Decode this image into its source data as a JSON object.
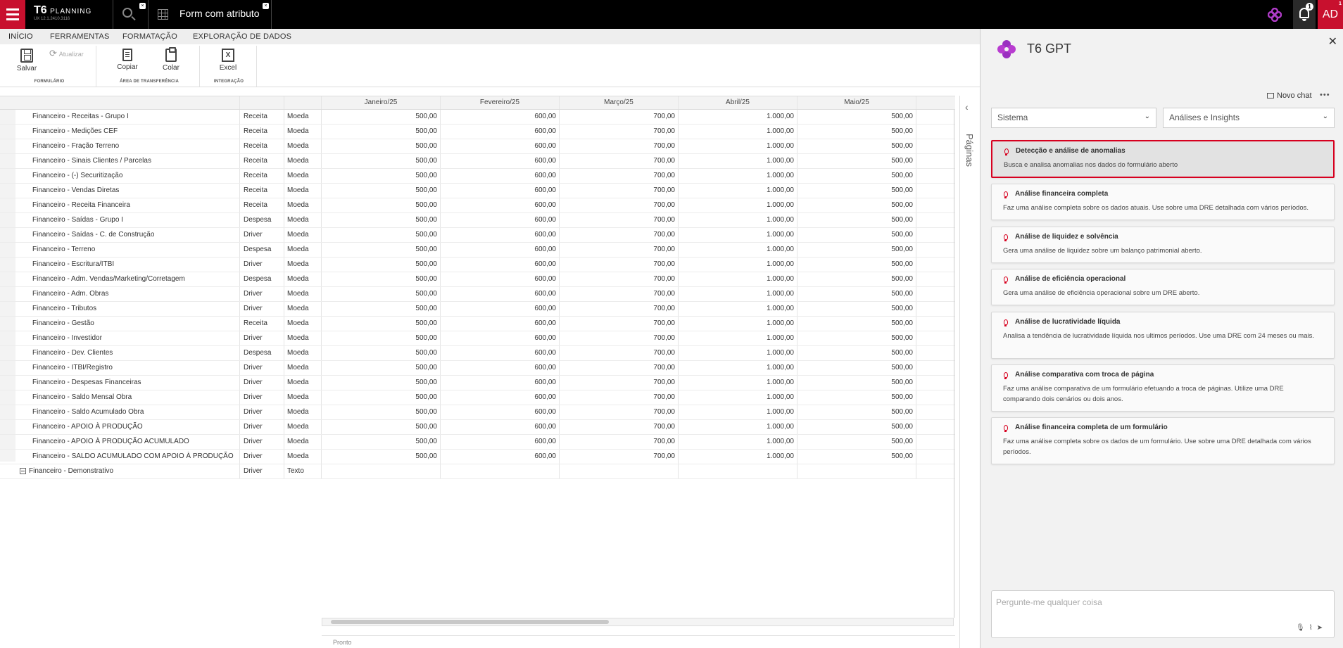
{
  "topbar": {
    "brand": "T6",
    "brand_sub": "PLANNING",
    "version": "UX 12.1.2410.3116",
    "tab_title": "Form com atributo",
    "notif_count": "1",
    "avatar": "AD",
    "avatar_badge": "1",
    "close_glyph": "×"
  },
  "ribbon": {
    "tabs": [
      "INÍCIO",
      "FERRAMENTAS",
      "FORMATAÇÃO",
      "EXPLORAÇÃO DE DADOS"
    ],
    "save": "Salvar",
    "refresh": "Atualizar",
    "copy": "Copiar",
    "paste": "Colar",
    "excel": "Excel",
    "excel_icon": "X",
    "groups": [
      "FORMULÁRIO",
      "ÁREA DE TRANSFERÊNCIA",
      "INTEGRAÇÃO"
    ]
  },
  "grid": {
    "months": [
      "Janeiro/25",
      "Fevereiro/25",
      "Março/25",
      "Abril/25",
      "Maio/25"
    ],
    "rows": [
      {
        "name": "Financeiro - Receitas - Grupo I",
        "type": "Receita",
        "unit": "Moeda",
        "v": [
          "500,00",
          "600,00",
          "700,00",
          "1.000,00",
          "500,00"
        ]
      },
      {
        "name": "Financeiro - Medições CEF",
        "type": "Receita",
        "unit": "Moeda",
        "v": [
          "500,00",
          "600,00",
          "700,00",
          "1.000,00",
          "500,00"
        ]
      },
      {
        "name": "Financeiro - Fração Terreno",
        "type": "Receita",
        "unit": "Moeda",
        "v": [
          "500,00",
          "600,00",
          "700,00",
          "1.000,00",
          "500,00"
        ]
      },
      {
        "name": "Financeiro - Sinais Clientes / Parcelas",
        "type": "Receita",
        "unit": "Moeda",
        "v": [
          "500,00",
          "600,00",
          "700,00",
          "1.000,00",
          "500,00"
        ]
      },
      {
        "name": "Financeiro - (-) Securitização",
        "type": "Receita",
        "unit": "Moeda",
        "v": [
          "500,00",
          "600,00",
          "700,00",
          "1.000,00",
          "500,00"
        ]
      },
      {
        "name": "Financeiro - Vendas Diretas",
        "type": "Receita",
        "unit": "Moeda",
        "v": [
          "500,00",
          "600,00",
          "700,00",
          "1.000,00",
          "500,00"
        ]
      },
      {
        "name": "Financeiro - Receita Financeira",
        "type": "Receita",
        "unit": "Moeda",
        "v": [
          "500,00",
          "600,00",
          "700,00",
          "1.000,00",
          "500,00"
        ]
      },
      {
        "name": "Financeiro - Saídas - Grupo I",
        "type": "Despesa",
        "unit": "Moeda",
        "v": [
          "500,00",
          "600,00",
          "700,00",
          "1.000,00",
          "500,00"
        ]
      },
      {
        "name": "Financeiro - Saídas - C. de Construção",
        "type": "Driver",
        "unit": "Moeda",
        "v": [
          "500,00",
          "600,00",
          "700,00",
          "1.000,00",
          "500,00"
        ]
      },
      {
        "name": "Financeiro - Terreno",
        "type": "Despesa",
        "unit": "Moeda",
        "v": [
          "500,00",
          "600,00",
          "700,00",
          "1.000,00",
          "500,00"
        ]
      },
      {
        "name": "Financeiro - Escritura/ITBI",
        "type": "Driver",
        "unit": "Moeda",
        "v": [
          "500,00",
          "600,00",
          "700,00",
          "1.000,00",
          "500,00"
        ]
      },
      {
        "name": "Financeiro - Adm. Vendas/Marketing/Corretagem",
        "type": "Despesa",
        "unit": "Moeda",
        "v": [
          "500,00",
          "600,00",
          "700,00",
          "1.000,00",
          "500,00"
        ]
      },
      {
        "name": "Financeiro - Adm. Obras",
        "type": "Driver",
        "unit": "Moeda",
        "v": [
          "500,00",
          "600,00",
          "700,00",
          "1.000,00",
          "500,00"
        ]
      },
      {
        "name": "Financeiro - Tributos",
        "type": "Driver",
        "unit": "Moeda",
        "v": [
          "500,00",
          "600,00",
          "700,00",
          "1.000,00",
          "500,00"
        ]
      },
      {
        "name": "Financeiro - Gestão",
        "type": "Receita",
        "unit": "Moeda",
        "v": [
          "500,00",
          "600,00",
          "700,00",
          "1.000,00",
          "500,00"
        ]
      },
      {
        "name": "Financeiro - Investidor",
        "type": "Driver",
        "unit": "Moeda",
        "v": [
          "500,00",
          "600,00",
          "700,00",
          "1.000,00",
          "500,00"
        ]
      },
      {
        "name": "Financeiro - Dev. Clientes",
        "type": "Despesa",
        "unit": "Moeda",
        "v": [
          "500,00",
          "600,00",
          "700,00",
          "1.000,00",
          "500,00"
        ]
      },
      {
        "name": "Financeiro - ITBI/Registro",
        "type": "Driver",
        "unit": "Moeda",
        "v": [
          "500,00",
          "600,00",
          "700,00",
          "1.000,00",
          "500,00"
        ]
      },
      {
        "name": "Financeiro - Despesas Financeiras",
        "type": "Driver",
        "unit": "Moeda",
        "v": [
          "500,00",
          "600,00",
          "700,00",
          "1.000,00",
          "500,00"
        ]
      },
      {
        "name": "Financeiro - Saldo Mensal Obra",
        "type": "Driver",
        "unit": "Moeda",
        "v": [
          "500,00",
          "600,00",
          "700,00",
          "1.000,00",
          "500,00"
        ]
      },
      {
        "name": "Financeiro - Saldo Acumulado Obra",
        "type": "Driver",
        "unit": "Moeda",
        "v": [
          "500,00",
          "600,00",
          "700,00",
          "1.000,00",
          "500,00"
        ]
      },
      {
        "name": "Financeiro - APOIO À PRODUÇÃO",
        "type": "Driver",
        "unit": "Moeda",
        "v": [
          "500,00",
          "600,00",
          "700,00",
          "1.000,00",
          "500,00"
        ]
      },
      {
        "name": "Financeiro - APOIO À PRODUÇÃO ACUMULADO",
        "type": "Driver",
        "unit": "Moeda",
        "v": [
          "500,00",
          "600,00",
          "700,00",
          "1.000,00",
          "500,00"
        ]
      },
      {
        "name": "Financeiro - SALDO ACUMULADO COM APOIO À PRODUÇÃO",
        "type": "Driver",
        "unit": "Moeda",
        "v": [
          "500,00",
          "600,00",
          "700,00",
          "1.000,00",
          "500,00"
        ]
      },
      {
        "name": "Financeiro - Demonstrativo",
        "type": "Driver",
        "unit": "Texto",
        "v": [
          "",
          "",
          "",
          "",
          ""
        ],
        "group": true
      }
    ],
    "status": "Pronto",
    "paginas": "Páginas"
  },
  "panel": {
    "title": "T6 GPT",
    "new_chat": "Novo chat",
    "more": "•••",
    "select_system": "Sistema",
    "select_category": "Análises e Insights",
    "cards": [
      {
        "title": "Detecção e análise de anomalias",
        "desc": "Busca e analisa anomalias nos dados do formulário aberto",
        "highlight": true
      },
      {
        "title": "Análise financeira completa",
        "desc": "Faz uma análise completa sobre os dados atuais. Use sobre uma DRE detalhada com vários períodos."
      },
      {
        "title": "Análise de liquidez e solvência",
        "desc": "Gera uma análise de liquidez sobre um balanço patrimonial aberto."
      },
      {
        "title": "Análise de eficiência operacional",
        "desc": "Gera uma análise de eficiência operacional sobre um DRE aberto."
      },
      {
        "title": "Análise de lucratividade líquida",
        "desc": "Analisa a tendência de lucratividade líquida nos ultimos períodos. Use uma DRE com 24 meses ou mais."
      },
      {
        "title": "Análise comparativa com troca de página",
        "desc": "Faz uma análise comparativa de um formulário efetuando a troca de páginas. Utilize uma DRE comparando dois cenários ou dois anos."
      },
      {
        "title": "Análise financeira completa de um formulário",
        "desc": "Faz uma análise completa sobre os dados de um formulário. Use sobre uma DRE detalhada com vários períodos."
      }
    ],
    "chat_placeholder": "Pergunte-me qualquer coisa"
  },
  "colors": {
    "accent": "#c8102e",
    "highlight_border": "#d7001f"
  }
}
